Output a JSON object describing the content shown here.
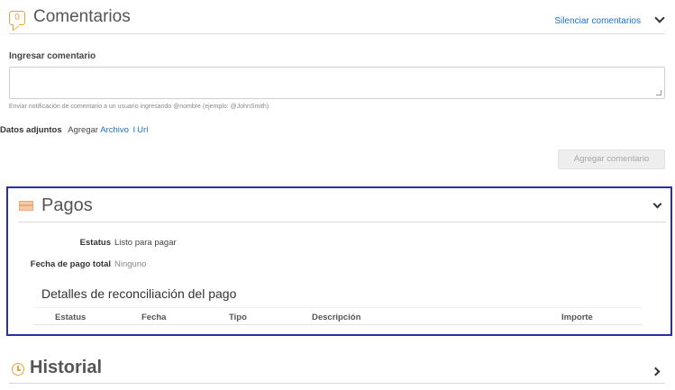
{
  "comments": {
    "icon": "comment-icon",
    "icon_glyph": "0",
    "title": "Comentarios",
    "mute_link": "Silenciar comentarios",
    "input_label": "Ingresar comentario",
    "input_value": "",
    "hint": "Enviar notificación de comentario a un usuario ingresando @nombre (ejemplo: @JohnSmith)",
    "attachments_label": "Datos adjuntos",
    "attachments_add": "Agregar",
    "attachments_file_link": "Archivo",
    "attachments_separator": "I",
    "attachments_url_link": "Url",
    "submit_button": "Agregar comentario"
  },
  "payments": {
    "icon": "credit-card-icon",
    "title": "Pagos",
    "status_label": "Estatus",
    "status_value": "Listo para pagar",
    "total_date_label": "Fecha de pago total",
    "total_date_value": "Ninguno",
    "reconciliation_title": "Detalles de reconciliación del pago",
    "columns": [
      "Estatus",
      "Fecha",
      "Tipo",
      "Descripción",
      "Importe"
    ]
  },
  "history": {
    "icon": "clock-icon",
    "title": "Historial"
  },
  "colors": {
    "link": "#1a73c9",
    "panel_highlight": "#2b2fa6",
    "icon_accent": "#e8a33c"
  }
}
